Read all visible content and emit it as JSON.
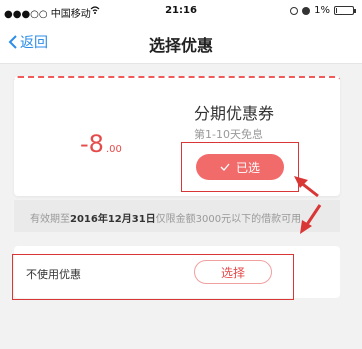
{
  "status_bar": {
    "carrier": "●●●○○ 中国移动",
    "time": "21:16",
    "battery_percent_text": "1%",
    "battery_level": 0.01
  },
  "nav": {
    "back_label": "返回",
    "title": "选择优惠"
  },
  "coupon": {
    "amount": "-8",
    "cents": ".00",
    "name": "分期优惠券",
    "description": "第1-10天免息",
    "selected_label": "已选",
    "selected_icon": "check-icon"
  },
  "validity": {
    "prefix": "有效期至",
    "date": "2016年12月31日",
    "suffix": "仅限金额3000元以下的借款可用"
  },
  "no_coupon": {
    "label": "不使用优惠",
    "choose_label": "选择"
  },
  "colors": {
    "accent": "#f26b6b",
    "link": "#2c8de8",
    "annotation": "#d93636"
  }
}
